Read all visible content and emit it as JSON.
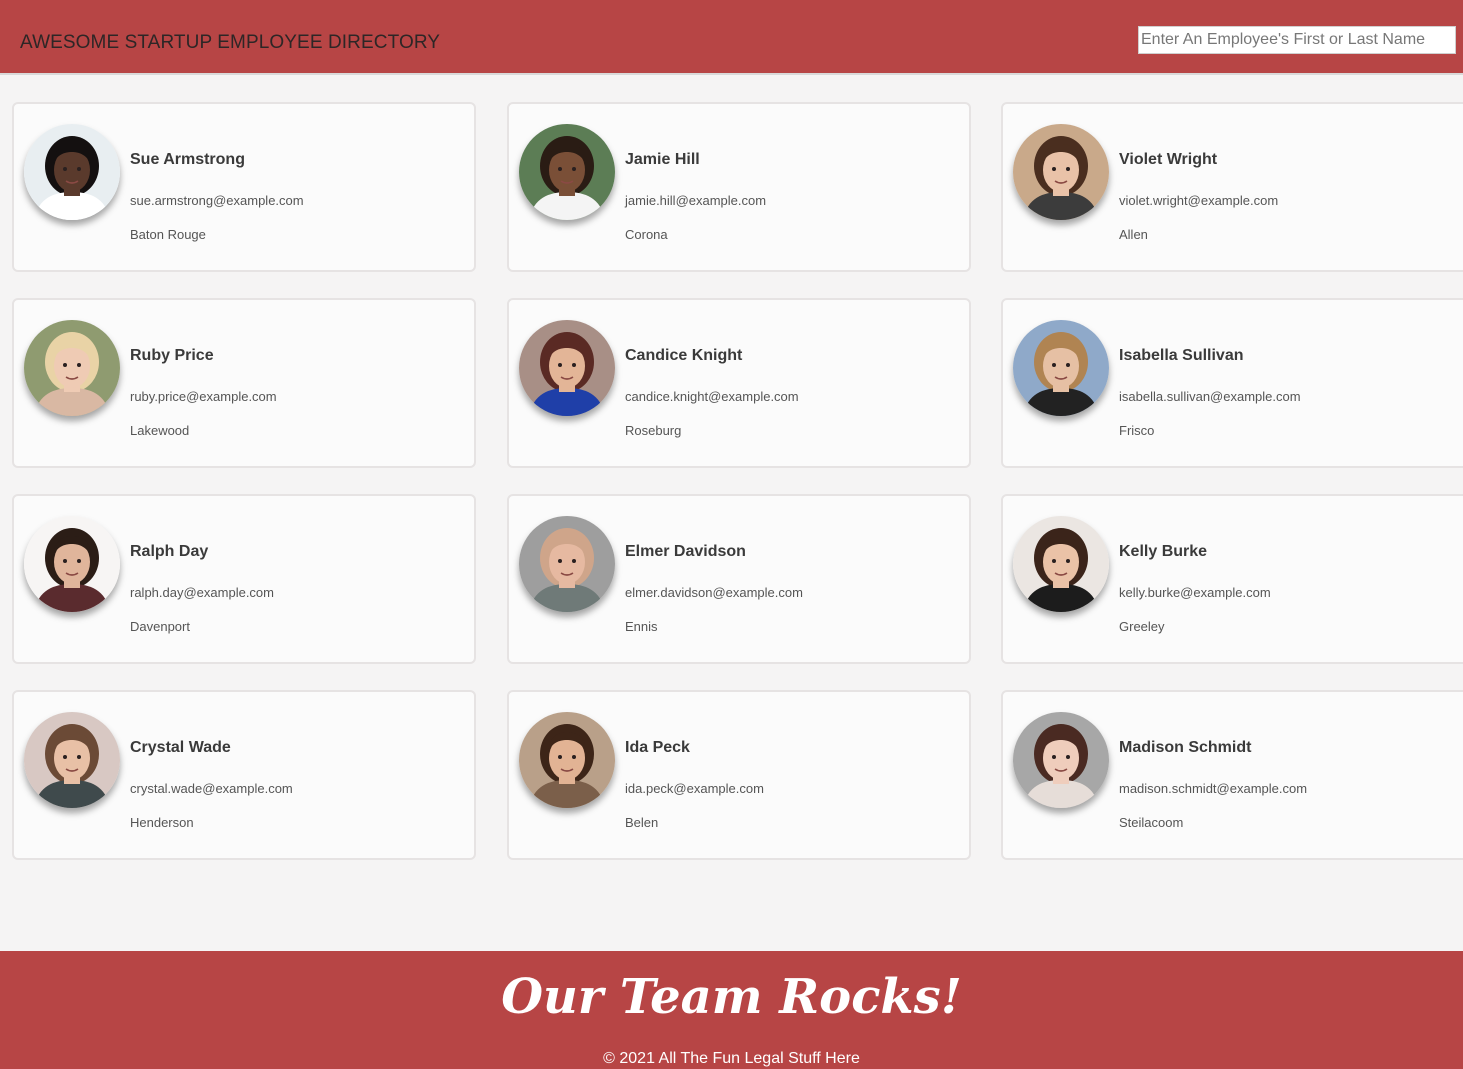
{
  "header": {
    "title": "AWESOME STARTUP EMPLOYEE DIRECTORY",
    "search_placeholder": "Enter An Employee's First or Last Name",
    "search_value": ""
  },
  "employees": [
    {
      "name": "Sue Armstrong",
      "email": "sue.armstrong@example.com",
      "city": "Baton Rouge",
      "skin": "#5a3a2c",
      "hair": "#141010",
      "bg": "#e8eef1",
      "shirt": "#ffffff"
    },
    {
      "name": "Jamie Hill",
      "email": "jamie.hill@example.com",
      "city": "Corona",
      "skin": "#7a4f37",
      "hair": "#2a1c14",
      "bg": "#5c7d55",
      "shirt": "#f4f4f4"
    },
    {
      "name": "Violet Wright",
      "email": "violet.wright@example.com",
      "city": "Allen",
      "skin": "#e9c2a8",
      "hair": "#4a2e1f",
      "bg": "#c9a98a",
      "shirt": "#3c3c3c"
    },
    {
      "name": "Ruby Price",
      "email": "ruby.price@example.com",
      "city": "Lakewood",
      "skin": "#efcbb4",
      "hair": "#e9d3a6",
      "bg": "#8f9b70",
      "shirt": "#d9b8a3"
    },
    {
      "name": "Candice Knight",
      "email": "candice.knight@example.com",
      "city": "Roseburg",
      "skin": "#e3b597",
      "hair": "#5a2a24",
      "bg": "#a88f86",
      "shirt": "#1f3fa8"
    },
    {
      "name": "Isabella Sullivan",
      "email": "isabella.sullivan@example.com",
      "city": "Frisco",
      "skin": "#e6c0a4",
      "hair": "#b08452",
      "bg": "#8fa9c9",
      "shirt": "#222222"
    },
    {
      "name": "Ralph Day",
      "email": "ralph.day@example.com",
      "city": "Davenport",
      "skin": "#e0b59b",
      "hair": "#2b1d16",
      "bg": "#f7f5f4",
      "shirt": "#5a2b2e"
    },
    {
      "name": "Elmer Davidson",
      "email": "elmer.davidson@example.com",
      "city": "Ennis",
      "skin": "#e6b9a1",
      "hair": "#cfa58a",
      "bg": "#9e9e9e",
      "shirt": "#6f7a78"
    },
    {
      "name": "Kelly Burke",
      "email": "kelly.burke@example.com",
      "city": "Greeley",
      "skin": "#eac2a7",
      "hair": "#3b241a",
      "bg": "#ebe6e2",
      "shirt": "#1c1c1c"
    },
    {
      "name": "Crystal Wade",
      "email": "crystal.wade@example.com",
      "city": "Henderson",
      "skin": "#e8c0a6",
      "hair": "#6b4a36",
      "bg": "#d8c8c3",
      "shirt": "#3f4a4c"
    },
    {
      "name": "Ida Peck",
      "email": "ida.peck@example.com",
      "city": "Belen",
      "skin": "#e2b394",
      "hair": "#3d2518",
      "bg": "#b9a089",
      "shirt": "#7b5f4a"
    },
    {
      "name": "Madison Schmidt",
      "email": "madison.schmidt@example.com",
      "city": "Steilacoom",
      "skin": "#efcdbc",
      "hair": "#4a2a22",
      "bg": "#a7a7a7",
      "shirt": "#e6ddd8"
    }
  ],
  "footer": {
    "slogan": "Our Team Rocks!",
    "legal": "© 2021 All The Fun Legal Stuff Here"
  },
  "colors": {
    "brand": "#b74545",
    "page_bg": "#f5f4f4",
    "card_bg": "#fbfbfb"
  }
}
